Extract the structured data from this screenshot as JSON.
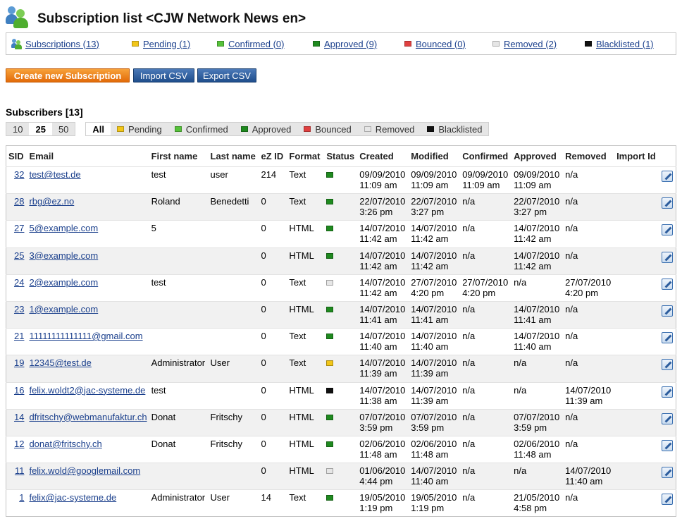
{
  "page": {
    "title": "Subscription list <CJW Network News en>"
  },
  "filters": [
    {
      "label": "Subscriptions (13)",
      "icon": "users-icon",
      "color": null
    },
    {
      "label": "Pending (1)",
      "icon": "pending-status-icon",
      "color": "#f2c618"
    },
    {
      "label": "Confirmed (0)",
      "icon": "confirmed-status-icon",
      "color": "#56c23a"
    },
    {
      "label": "Approved (9)",
      "icon": "approved-status-icon",
      "color": "#1f8a1f"
    },
    {
      "label": "Bounced (0)",
      "icon": "bounced-status-icon",
      "color": "#e04040"
    },
    {
      "label": "Removed (2)",
      "icon": "removed-status-icon",
      "color": "#e6e6e6"
    },
    {
      "label": "Blacklisted (1)",
      "icon": "blacklisted-status-icon",
      "color": "#111111"
    }
  ],
  "actions": {
    "create": "Create new Subscription",
    "import": "Import CSV",
    "export": "Export CSV"
  },
  "subscribers": {
    "title": "Subscribers [13]",
    "page_sizes": [
      "10",
      "25",
      "50"
    ],
    "active_page_size": "25",
    "status_tabs": [
      {
        "label": "All",
        "color": null
      },
      {
        "label": "Pending",
        "color": "#f2c618"
      },
      {
        "label": "Confirmed",
        "color": "#56c23a"
      },
      {
        "label": "Approved",
        "color": "#1f8a1f"
      },
      {
        "label": "Bounced",
        "color": "#e04040"
      },
      {
        "label": "Removed",
        "color": "#e6e6e6"
      },
      {
        "label": "Blacklisted",
        "color": "#111111"
      }
    ],
    "active_status_tab": "All",
    "columns": [
      "SID",
      "Email",
      "First name",
      "Last name",
      "eZ ID",
      "Format",
      "Status",
      "Created",
      "Modified",
      "Confirmed",
      "Approved",
      "Removed",
      "Import Id"
    ],
    "rows": [
      {
        "sid": "32",
        "email": "test@test.de",
        "first": "test",
        "last": "user",
        "ezid": "214",
        "format": "Text",
        "status": "approved",
        "created": [
          "09/09/2010",
          "11:09 am"
        ],
        "modified": [
          "09/09/2010",
          "11:09 am"
        ],
        "confirmed": [
          "09/09/2010",
          "11:09 am"
        ],
        "approved": [
          "09/09/2010",
          "11:09 am"
        ],
        "removed": [
          "n/a",
          ""
        ]
      },
      {
        "sid": "28",
        "email": "rbg@ez.no",
        "first": "Roland",
        "last": "Benedetti",
        "ezid": "0",
        "format": "Text",
        "status": "approved",
        "created": [
          "22/07/2010",
          "3:26 pm"
        ],
        "modified": [
          "22/07/2010",
          "3:27 pm"
        ],
        "confirmed": [
          "n/a",
          ""
        ],
        "approved": [
          "22/07/2010",
          "3:27 pm"
        ],
        "removed": [
          "n/a",
          ""
        ]
      },
      {
        "sid": "27",
        "email": "5@example.com",
        "first": "5",
        "last": "",
        "ezid": "0",
        "format": "HTML",
        "status": "approved",
        "created": [
          "14/07/2010",
          "11:42 am"
        ],
        "modified": [
          "14/07/2010",
          "11:42 am"
        ],
        "confirmed": [
          "n/a",
          ""
        ],
        "approved": [
          "14/07/2010",
          "11:42 am"
        ],
        "removed": [
          "n/a",
          ""
        ]
      },
      {
        "sid": "25",
        "email": "3@example.com",
        "first": "",
        "last": "",
        "ezid": "0",
        "format": "HTML",
        "status": "approved",
        "created": [
          "14/07/2010",
          "11:42 am"
        ],
        "modified": [
          "14/07/2010",
          "11:42 am"
        ],
        "confirmed": [
          "n/a",
          ""
        ],
        "approved": [
          "14/07/2010",
          "11:42 am"
        ],
        "removed": [
          "n/a",
          ""
        ]
      },
      {
        "sid": "24",
        "email": "2@example.com",
        "first": "test",
        "last": "",
        "ezid": "0",
        "format": "Text",
        "status": "removed",
        "created": [
          "14/07/2010",
          "11:42 am"
        ],
        "modified": [
          "27/07/2010",
          "4:20 pm"
        ],
        "confirmed": [
          "27/07/2010",
          "4:20 pm"
        ],
        "approved": [
          "n/a",
          ""
        ],
        "removed": [
          "27/07/2010",
          "4:20 pm"
        ]
      },
      {
        "sid": "23",
        "email": "1@example.com",
        "first": "",
        "last": "",
        "ezid": "0",
        "format": "HTML",
        "status": "approved",
        "created": [
          "14/07/2010",
          "11:41 am"
        ],
        "modified": [
          "14/07/2010",
          "11:41 am"
        ],
        "confirmed": [
          "n/a",
          ""
        ],
        "approved": [
          "14/07/2010",
          "11:41 am"
        ],
        "removed": [
          "n/a",
          ""
        ]
      },
      {
        "sid": "21",
        "email": "11111111111111@gmail.com",
        "first": "",
        "last": "",
        "ezid": "0",
        "format": "Text",
        "status": "approved",
        "created": [
          "14/07/2010",
          "11:40 am"
        ],
        "modified": [
          "14/07/2010",
          "11:40 am"
        ],
        "confirmed": [
          "n/a",
          ""
        ],
        "approved": [
          "14/07/2010",
          "11:40 am"
        ],
        "removed": [
          "n/a",
          ""
        ]
      },
      {
        "sid": "19",
        "email": "12345@test.de",
        "first": "Administrator",
        "last": "User",
        "ezid": "0",
        "format": "Text",
        "status": "pending",
        "created": [
          "14/07/2010",
          "11:39 am"
        ],
        "modified": [
          "14/07/2010",
          "11:39 am"
        ],
        "confirmed": [
          "n/a",
          ""
        ],
        "approved": [
          "n/a",
          ""
        ],
        "removed": [
          "n/a",
          ""
        ]
      },
      {
        "sid": "16",
        "email": "felix.woldt2@jac-systeme.de",
        "first": "test",
        "last": "",
        "ezid": "0",
        "format": "HTML",
        "status": "blacklisted",
        "created": [
          "14/07/2010",
          "11:38 am"
        ],
        "modified": [
          "14/07/2010",
          "11:39 am"
        ],
        "confirmed": [
          "n/a",
          ""
        ],
        "approved": [
          "n/a",
          ""
        ],
        "removed": [
          "14/07/2010",
          "11:39 am"
        ]
      },
      {
        "sid": "14",
        "email": "dfritschy@webmanufaktur.ch",
        "first": "Donat",
        "last": "Fritschy",
        "ezid": "0",
        "format": "HTML",
        "status": "approved",
        "created": [
          "07/07/2010",
          "3:59 pm"
        ],
        "modified": [
          "07/07/2010",
          "3:59 pm"
        ],
        "confirmed": [
          "n/a",
          ""
        ],
        "approved": [
          "07/07/2010",
          "3:59 pm"
        ],
        "removed": [
          "n/a",
          ""
        ]
      },
      {
        "sid": "12",
        "email": "donat@fritschy.ch",
        "first": "Donat",
        "last": "Fritschy",
        "ezid": "0",
        "format": "HTML",
        "status": "approved",
        "created": [
          "02/06/2010",
          "11:48 am"
        ],
        "modified": [
          "02/06/2010",
          "11:48 am"
        ],
        "confirmed": [
          "n/a",
          ""
        ],
        "approved": [
          "02/06/2010",
          "11:48 am"
        ],
        "removed": [
          "n/a",
          ""
        ]
      },
      {
        "sid": "11",
        "email": "felix.wold@googlemail.com",
        "first": "",
        "last": "",
        "ezid": "0",
        "format": "HTML",
        "status": "removed",
        "created": [
          "01/06/2010",
          "4:44 pm"
        ],
        "modified": [
          "14/07/2010",
          "11:40 am"
        ],
        "confirmed": [
          "n/a",
          ""
        ],
        "approved": [
          "n/a",
          ""
        ],
        "removed": [
          "14/07/2010",
          "11:40 am"
        ]
      },
      {
        "sid": "1",
        "email": "felix@jac-systeme.de",
        "first": "Administrator",
        "last": "User",
        "ezid": "14",
        "format": "Text",
        "status": "approved",
        "created": [
          "19/05/2010",
          "1:19 pm"
        ],
        "modified": [
          "19/05/2010",
          "1:19 pm"
        ],
        "confirmed": [
          "n/a",
          ""
        ],
        "approved": [
          "21/05/2010",
          "4:58 pm"
        ],
        "removed": [
          "n/a",
          ""
        ]
      }
    ]
  },
  "status_colors": {
    "pending": "#f2c618",
    "confirmed": "#56c23a",
    "approved": "#1f8a1f",
    "bounced": "#e04040",
    "removed": "#e6e6e6",
    "blacklisted": "#111111"
  }
}
